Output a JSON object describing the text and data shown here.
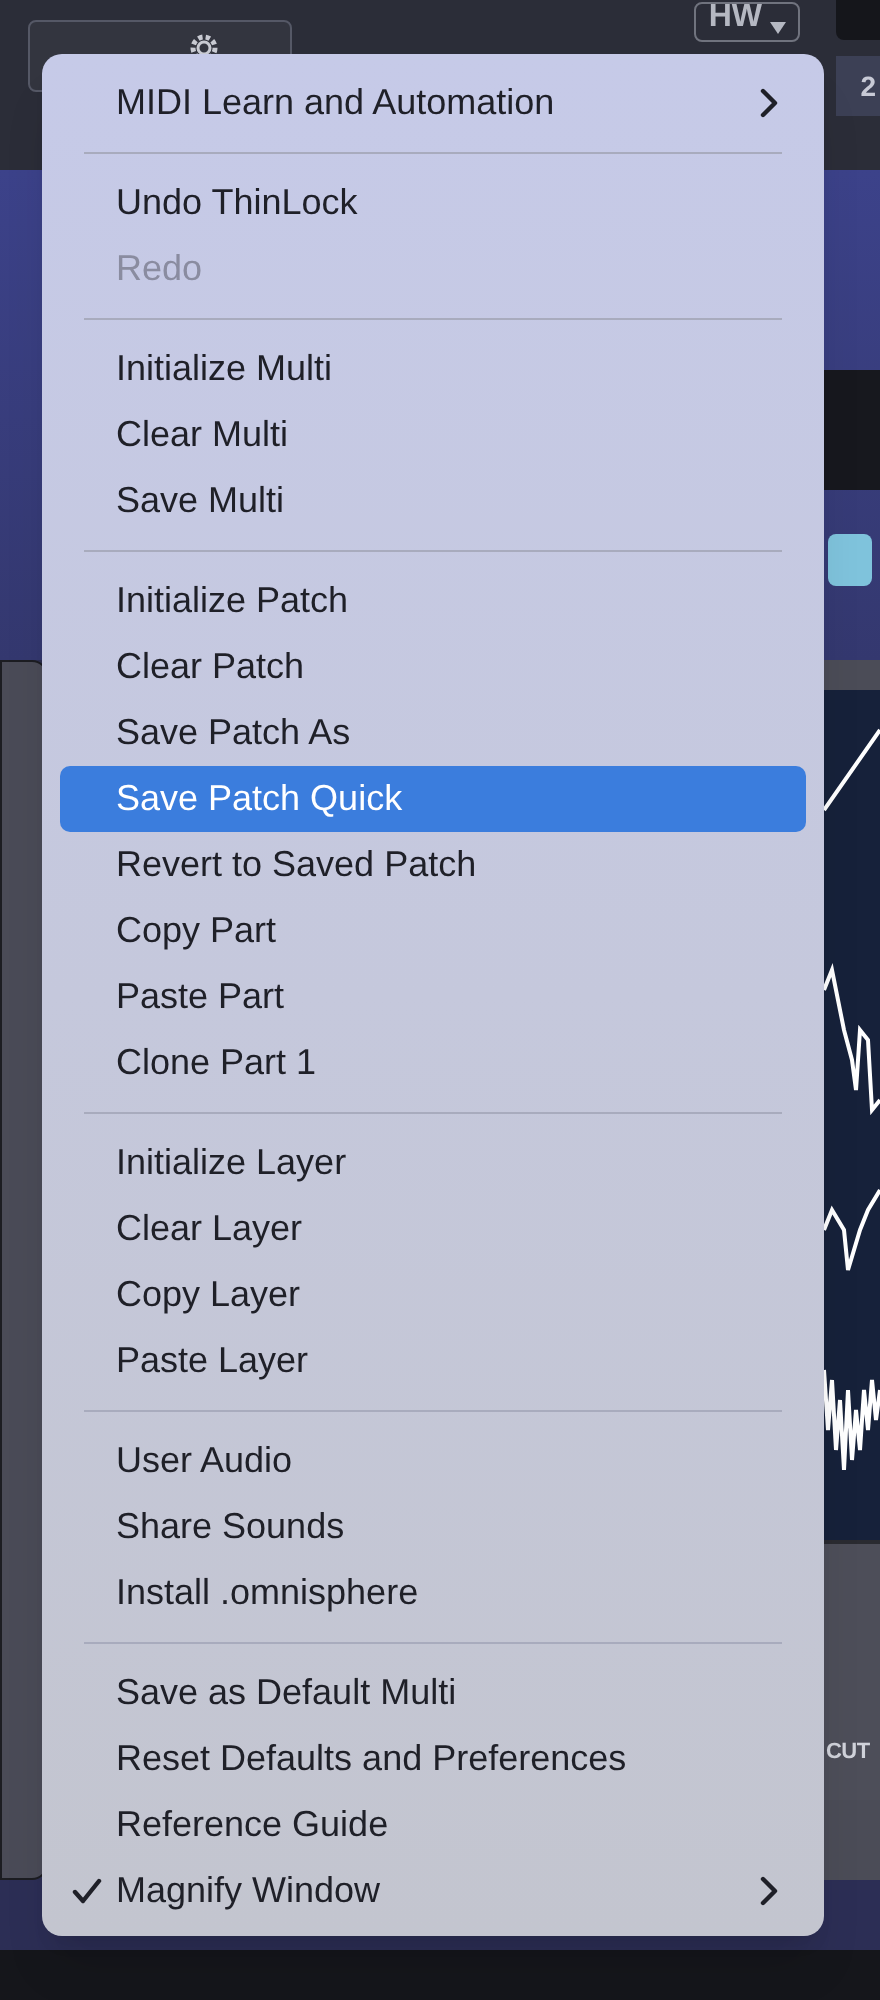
{
  "hw_dropdown": {
    "label": "HW"
  },
  "part_tab": {
    "label": "2"
  },
  "cutoff_label": "CUT",
  "menu": {
    "sections": [
      [
        {
          "label": "MIDI Learn and Automation",
          "selected": false,
          "disabled": false,
          "checked": false,
          "submenu": true
        }
      ],
      [
        {
          "label": "Undo ThinLock",
          "selected": false,
          "disabled": false,
          "checked": false,
          "submenu": false
        },
        {
          "label": "Redo",
          "selected": false,
          "disabled": true,
          "checked": false,
          "submenu": false
        }
      ],
      [
        {
          "label": "Initialize Multi",
          "selected": false,
          "disabled": false,
          "checked": false,
          "submenu": false
        },
        {
          "label": "Clear Multi",
          "selected": false,
          "disabled": false,
          "checked": false,
          "submenu": false
        },
        {
          "label": "Save Multi",
          "selected": false,
          "disabled": false,
          "checked": false,
          "submenu": false
        }
      ],
      [
        {
          "label": "Initialize Patch",
          "selected": false,
          "disabled": false,
          "checked": false,
          "submenu": false
        },
        {
          "label": "Clear Patch",
          "selected": false,
          "disabled": false,
          "checked": false,
          "submenu": false
        },
        {
          "label": "Save Patch As",
          "selected": false,
          "disabled": false,
          "checked": false,
          "submenu": false
        },
        {
          "label": "Save Patch Quick",
          "selected": true,
          "disabled": false,
          "checked": false,
          "submenu": false
        },
        {
          "label": "Revert to Saved Patch",
          "selected": false,
          "disabled": false,
          "checked": false,
          "submenu": false
        },
        {
          "label": "Copy Part",
          "selected": false,
          "disabled": false,
          "checked": false,
          "submenu": false
        },
        {
          "label": "Paste Part",
          "selected": false,
          "disabled": false,
          "checked": false,
          "submenu": false
        },
        {
          "label": "Clone Part 1",
          "selected": false,
          "disabled": false,
          "checked": false,
          "submenu": false
        }
      ],
      [
        {
          "label": "Initialize Layer",
          "selected": false,
          "disabled": false,
          "checked": false,
          "submenu": false
        },
        {
          "label": "Clear Layer",
          "selected": false,
          "disabled": false,
          "checked": false,
          "submenu": false
        },
        {
          "label": "Copy Layer",
          "selected": false,
          "disabled": false,
          "checked": false,
          "submenu": false
        },
        {
          "label": "Paste Layer",
          "selected": false,
          "disabled": false,
          "checked": false,
          "submenu": false
        }
      ],
      [
        {
          "label": "User Audio",
          "selected": false,
          "disabled": false,
          "checked": false,
          "submenu": false
        },
        {
          "label": "Share Sounds",
          "selected": false,
          "disabled": false,
          "checked": false,
          "submenu": false
        },
        {
          "label": "Install .omnisphere",
          "selected": false,
          "disabled": false,
          "checked": false,
          "submenu": false
        }
      ],
      [
        {
          "label": "Save as Default Multi",
          "selected": false,
          "disabled": false,
          "checked": false,
          "submenu": false
        },
        {
          "label": "Reset Defaults and Preferences",
          "selected": false,
          "disabled": false,
          "checked": false,
          "submenu": false
        },
        {
          "label": "Reference Guide",
          "selected": false,
          "disabled": false,
          "checked": false,
          "submenu": false
        },
        {
          "label": "Magnify Window",
          "selected": false,
          "disabled": false,
          "checked": true,
          "submenu": true
        }
      ]
    ]
  }
}
